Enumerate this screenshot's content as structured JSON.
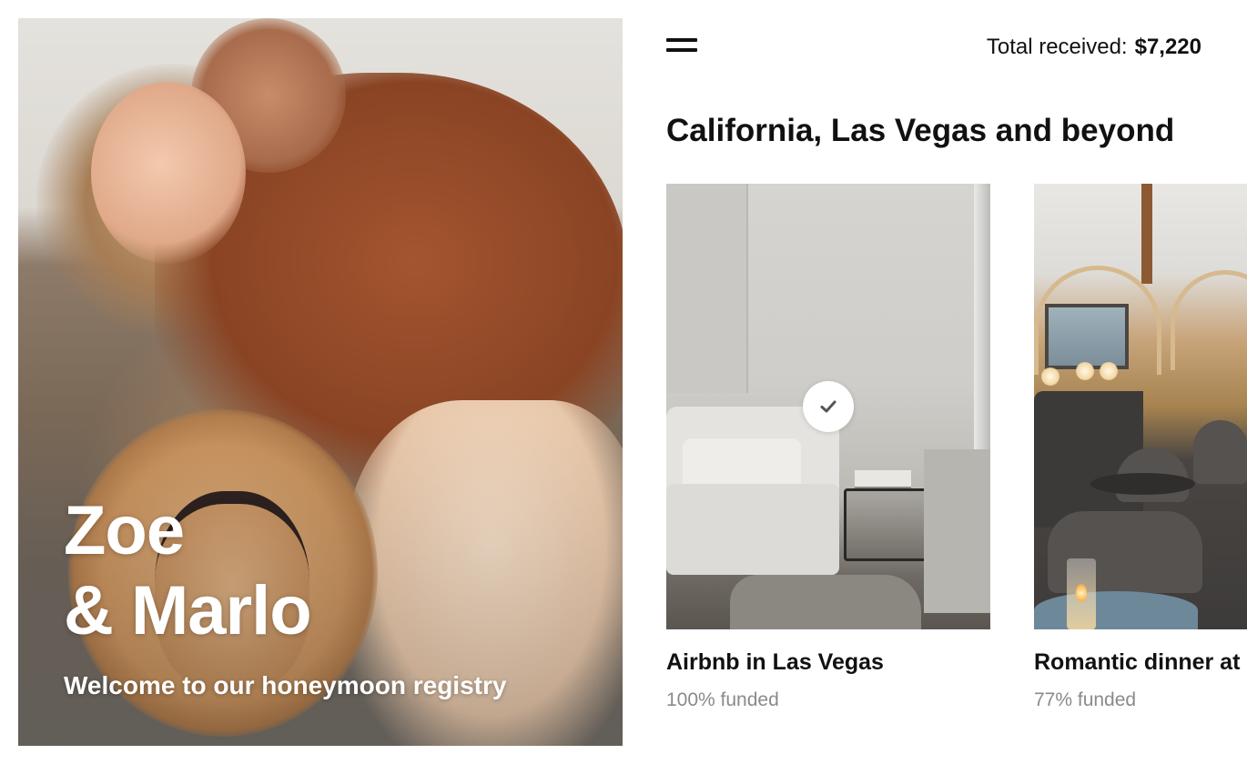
{
  "hero": {
    "title_line1": "Zoe",
    "title_line2": "& Marlo",
    "subtitle": "Welcome to our honeymoon registry"
  },
  "header": {
    "menu_icon": "hamburger-menu-icon",
    "total_label": "Total received:",
    "total_amount": "$7,220"
  },
  "section": {
    "title": "California, Las Vegas and beyond"
  },
  "cards": [
    {
      "title": "Airbnb in Las Vegas",
      "funded": "100% funded",
      "funded_fraction": 1.0,
      "completed": true,
      "badge_icon": "checkmark-icon"
    },
    {
      "title": "Romantic dinner at",
      "funded": "77% funded",
      "funded_fraction": 0.77,
      "completed": false
    }
  ],
  "colors": {
    "text": "#111111",
    "muted": "#8a8a8a",
    "background": "#ffffff",
    "hero_text": "#ffffff"
  }
}
